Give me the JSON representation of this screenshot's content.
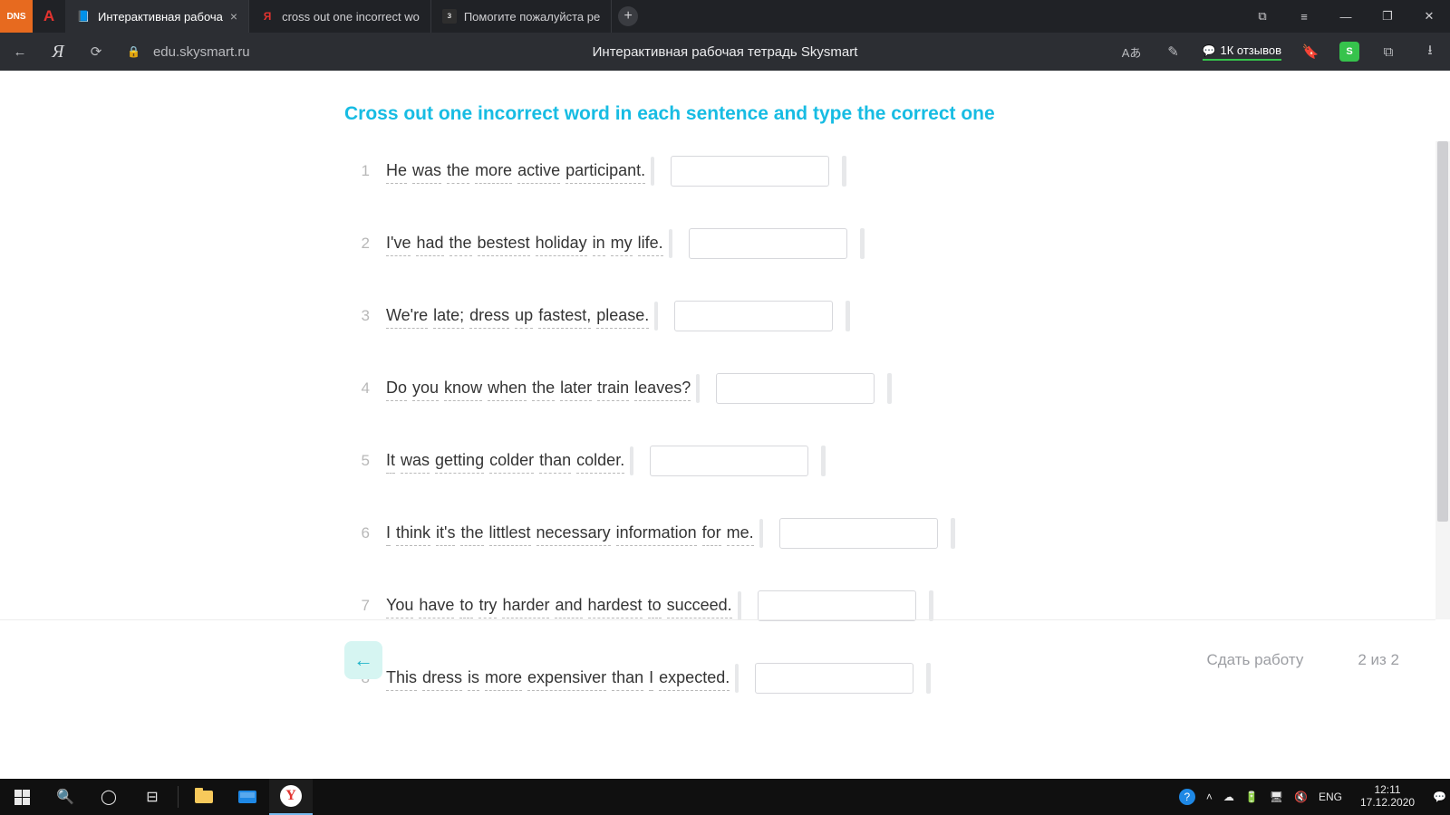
{
  "tabs": [
    {
      "fav": "📘",
      "title": "Интерактивная рабоча",
      "active": true
    },
    {
      "fav": "Я",
      "title": "cross out one incorrect wo",
      "active": false,
      "favColor": "#e2332f"
    },
    {
      "fav": "з",
      "title": "Помогите пожалуйста ре",
      "active": false,
      "favBg": "#2e2e2e"
    }
  ],
  "address": {
    "url": "edu.skysmart.ru",
    "pageTitle": "Интерактивная рабочая тетрадь Skysmart",
    "reviews": "1К отзывов",
    "shield": "S"
  },
  "exercise": {
    "instruction": "Cross out one incorrect word in each sentence and type the correct one",
    "items": [
      {
        "n": "1",
        "words": [
          "He",
          "was",
          "the",
          "more",
          "active",
          "participant."
        ]
      },
      {
        "n": "2",
        "words": [
          "I've",
          "had",
          "the",
          "bestest",
          "holiday",
          "in",
          "my",
          "life."
        ]
      },
      {
        "n": "3",
        "words": [
          "We're",
          "late;",
          "dress",
          "up",
          "fastest,",
          "please."
        ]
      },
      {
        "n": "4",
        "words": [
          "Do",
          "you",
          "know",
          "when",
          "the",
          "later",
          "train",
          "leaves?"
        ]
      },
      {
        "n": "5",
        "words": [
          "It",
          "was",
          "getting",
          "colder",
          "than",
          "colder."
        ]
      },
      {
        "n": "6",
        "words": [
          "I",
          "think",
          "it's",
          "the",
          "littlest",
          "necessary",
          "information",
          "for",
          "me."
        ]
      },
      {
        "n": "7",
        "words": [
          "You",
          "have",
          "to",
          "try",
          "harder",
          "and",
          "hardest",
          "to",
          "succeed."
        ]
      },
      {
        "n": "8",
        "words": [
          "This",
          "dress",
          "is",
          "more",
          "expensiver",
          "than",
          "I",
          "expected."
        ]
      }
    ]
  },
  "footer": {
    "submit": "Сдать работу",
    "progress": "2 из 2"
  },
  "system": {
    "lang": "ENG",
    "time": "12:11",
    "date": "17.12.2020"
  }
}
